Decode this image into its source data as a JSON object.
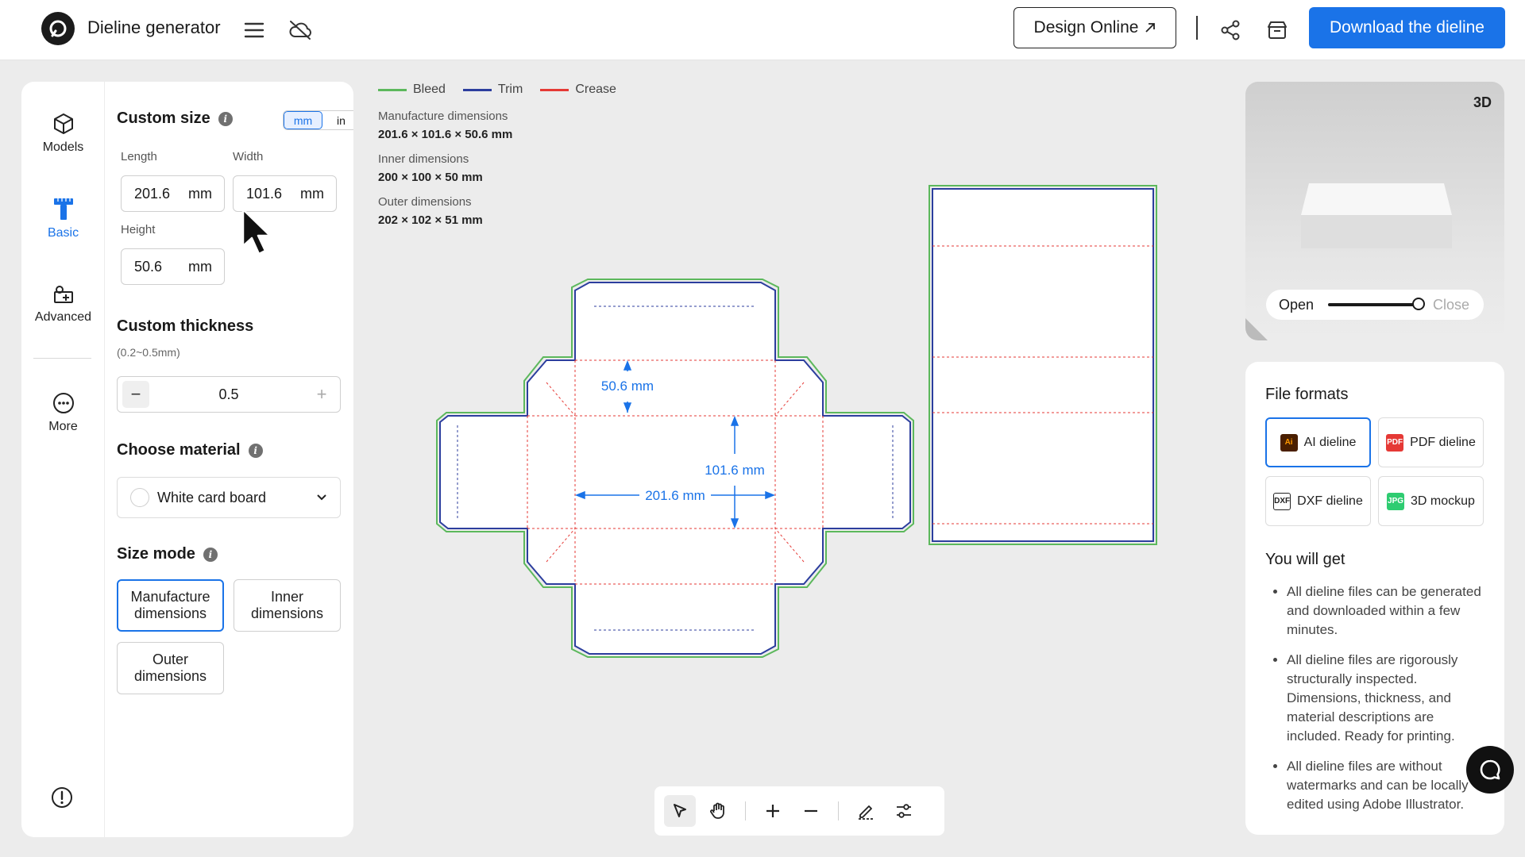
{
  "header": {
    "app_title": "Dieline generator",
    "design_online_label": "Design Online",
    "download_label": "Download the dieline"
  },
  "rail": {
    "items": [
      {
        "label": "Models"
      },
      {
        "label": "Basic"
      },
      {
        "label": "Advanced"
      },
      {
        "label": "More"
      }
    ]
  },
  "custom_size": {
    "title": "Custom size",
    "unit_mm": "mm",
    "unit_in": "in",
    "length_label": "Length",
    "length_value": "201.6",
    "width_label": "Width",
    "width_value": "101.6",
    "height_label": "Height",
    "height_value": "50.6",
    "unit": "mm"
  },
  "thickness": {
    "title": "Custom thickness",
    "range": "(0.2~0.5mm)",
    "value": "0.5"
  },
  "material": {
    "title": "Choose material",
    "selected": "White card board"
  },
  "size_mode": {
    "title": "Size mode",
    "manufacture": "Manufacture dimensions",
    "inner": "Inner dimensions",
    "outer": "Outer dimensions"
  },
  "legend": {
    "bleed": "Bleed",
    "trim": "Trim",
    "crease": "Crease",
    "bleed_color": "#5cb85c",
    "trim_color": "#2c3e9e",
    "crease_color": "#e53935"
  },
  "dimensions": {
    "manufacture_label": "Manufacture dimensions",
    "manufacture_value": "201.6 × 101.6 × 50.6 mm",
    "inner_label": "Inner dimensions",
    "inner_value": "200 × 100 × 50 mm",
    "outer_label": "Outer dimensions",
    "outer_value": "202 × 102 × 51 mm"
  },
  "dieline_labels": {
    "height": "50.6 mm",
    "width": "101.6 mm",
    "length": "201.6 mm"
  },
  "preview3d": {
    "badge": "3D",
    "open_label": "Open",
    "close_label": "Close"
  },
  "file_formats": {
    "title": "File formats",
    "ai": "AI dieline",
    "pdf": "PDF dieline",
    "dxf": "DXF dieline",
    "mockup": "3D mockup"
  },
  "you_will_get": {
    "title": "You will get",
    "items": [
      "All dieline files can be generated and downloaded within a few minutes.",
      "All dieline files are rigorously structurally inspected. Dimensions, thickness, and material descriptions are included. Ready for printing.",
      "All dieline files are without watermarks and can be locally edited using Adobe Illustrator."
    ]
  },
  "accent_color": "#1a73e8"
}
